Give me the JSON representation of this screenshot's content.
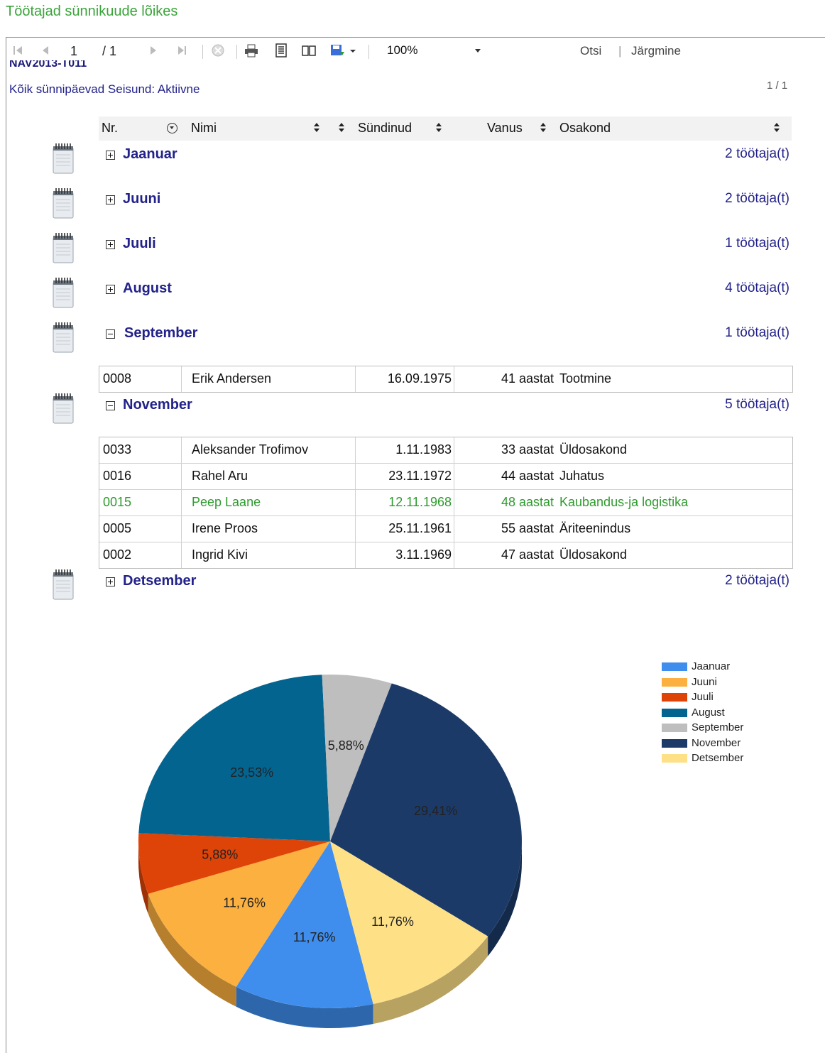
{
  "page": {
    "title": "Töötajad sünnikuude lõikes",
    "company_cut": "NAV2013-T011",
    "filter_line": "Kõik sünnipäevad Seisund: Aktiivne",
    "page_number": "1 / 1"
  },
  "toolbar": {
    "current_page": "1",
    "page_total": "/ 1",
    "zoom": "100%",
    "search_label": "Otsi",
    "next_label": "Järgmine",
    "separator": "|",
    "icons": [
      "first-page-icon",
      "prev-page-icon",
      "next-page-icon",
      "last-page-icon",
      "stop-icon",
      "print-icon",
      "page-setup-icon",
      "book-view-icon",
      "save-icon",
      "dropdown-icon"
    ]
  },
  "columns": {
    "nr": "Nr.",
    "name": "Nimi",
    "born": "Sündinud",
    "age": "Vanus",
    "department": "Osakond"
  },
  "groups": [
    {
      "name": "Jaanuar",
      "count": "2 töötaja(t)",
      "expanded": false
    },
    {
      "name": "Juuni",
      "count": "2 töötaja(t)",
      "expanded": false
    },
    {
      "name": "Juuli",
      "count": "1 töötaja(t)",
      "expanded": false
    },
    {
      "name": "August",
      "count": "4 töötaja(t)",
      "expanded": false
    },
    {
      "name": "September",
      "count": "1 töötaja(t)",
      "expanded": true
    },
    {
      "name": "November",
      "count": "5 töötaja(t)",
      "expanded": true
    },
    {
      "name": "Detsember",
      "count": "2 töötaja(t)",
      "expanded": false
    }
  ],
  "september_rows": [
    {
      "nr": "0008",
      "name": "Erik Andersen",
      "born": "16.09.1975",
      "age": "41 aastat",
      "department": "Tootmine"
    }
  ],
  "november_rows": [
    {
      "nr": "0033",
      "name": "Aleksander Trofimov",
      "born": "1.11.1983",
      "age": "33 aastat",
      "department": "Üldosakond"
    },
    {
      "nr": "0016",
      "name": "Rahel Aru",
      "born": "23.11.1972",
      "age": "44 aastat",
      "department": "Juhatus"
    },
    {
      "nr": "0015",
      "name": "Peep Laane",
      "born": "12.11.1968",
      "age": "48 aastat",
      "department": "Kaubandus-ja logistika",
      "highlight": "#2e9b2e"
    },
    {
      "nr": "0005",
      "name": "Irene Proos",
      "born": "25.11.1961",
      "age": "55 aastat",
      "department": "Äriteenindus"
    },
    {
      "nr": "0002",
      "name": "Ingrid Kivi",
      "born": "3.11.1969",
      "age": "47 aastat",
      "department": "Üldosakond"
    }
  ],
  "chart_data": {
    "type": "pie",
    "categories": [
      "Jaanuar",
      "Juuni",
      "Juuli",
      "August",
      "September",
      "November",
      "Detsember"
    ],
    "values": [
      11.76,
      11.76,
      5.88,
      23.53,
      5.88,
      29.41,
      11.76
    ],
    "labels": [
      "11,76%",
      "11,76%",
      "5,88%",
      "23,53%",
      "5,88%",
      "29,41%",
      "11,76%"
    ],
    "colors": [
      "#3f8ded",
      "#fbb040",
      "#de4307",
      "#046490",
      "#bebebe",
      "#1c3a68",
      "#fee187"
    ],
    "legend_position": "top-right"
  }
}
